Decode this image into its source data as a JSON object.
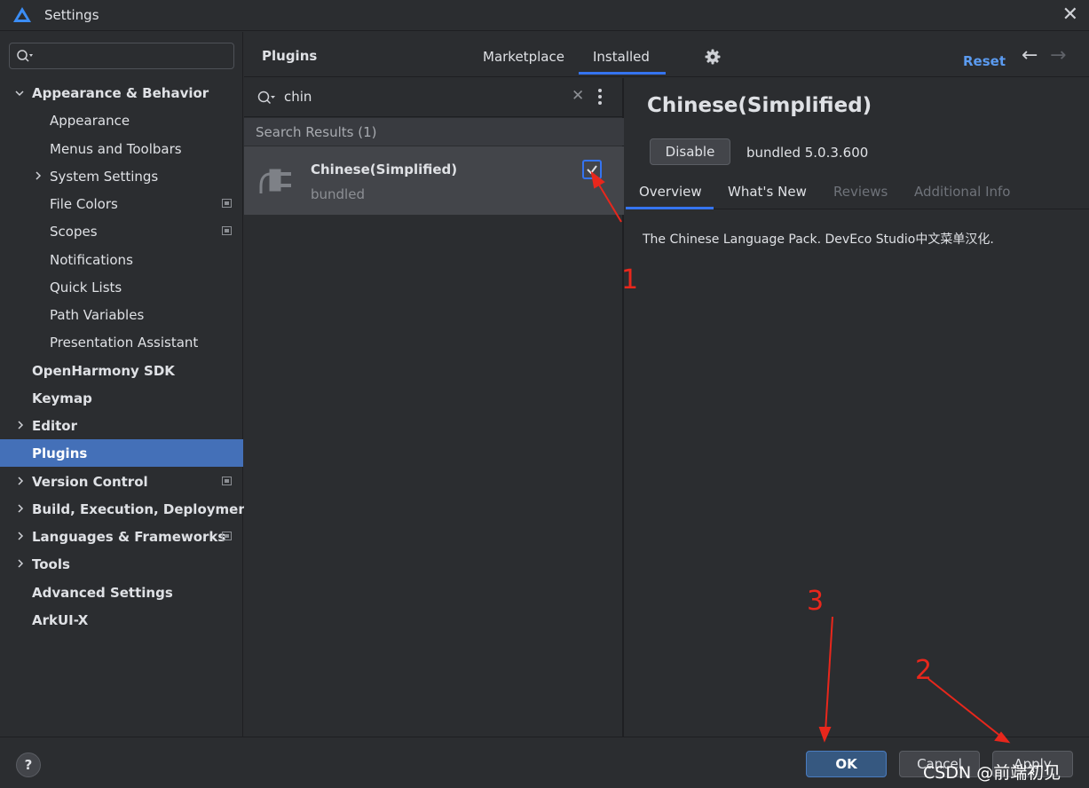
{
  "window": {
    "title": "Settings",
    "close_symbol": "✕"
  },
  "sidebar": {
    "search_placeholder": "",
    "items": [
      {
        "label": "Appearance & Behavior"
      },
      {
        "label": "Appearance"
      },
      {
        "label": "Menus and Toolbars"
      },
      {
        "label": "System Settings"
      },
      {
        "label": "File Colors"
      },
      {
        "label": "Scopes"
      },
      {
        "label": "Notifications"
      },
      {
        "label": "Quick Lists"
      },
      {
        "label": "Path Variables"
      },
      {
        "label": "Presentation Assistant"
      },
      {
        "label": "OpenHarmony SDK"
      },
      {
        "label": "Keymap"
      },
      {
        "label": "Editor"
      },
      {
        "label": "Plugins"
      },
      {
        "label": "Version Control"
      },
      {
        "label": "Build, Execution, Deployment"
      },
      {
        "label": "Languages & Frameworks"
      },
      {
        "label": "Tools"
      },
      {
        "label": "Advanced Settings"
      },
      {
        "label": "ArkUI-X"
      }
    ]
  },
  "header": {
    "title": "Plugins",
    "tabs": [
      {
        "label": "Marketplace"
      },
      {
        "label": "Installed"
      }
    ],
    "active_tab": "Installed",
    "reset_label": "Reset",
    "back_symbol": "←",
    "forward_symbol": "→"
  },
  "plugin_list": {
    "search_value": "chin",
    "clear_symbol": "✕",
    "results_header": "Search Results (1)",
    "items": [
      {
        "name": "Chinese(Simplified)",
        "subtitle": "bundled",
        "enabled": true
      }
    ]
  },
  "detail": {
    "title": "Chinese(Simplified)",
    "disable_label": "Disable",
    "version": "bundled 5.0.3.600",
    "tabs": [
      {
        "label": "Overview"
      },
      {
        "label": "What's New"
      },
      {
        "label": "Reviews"
      },
      {
        "label": "Additional Info"
      }
    ],
    "active_tab": "Overview",
    "description": "The Chinese Language Pack. DevEco Studio中文菜单汉化."
  },
  "footer": {
    "help_label": "?",
    "ok_label": "OK",
    "cancel_label": "Cancel",
    "apply_label": "Apply"
  },
  "annotations": {
    "step1": "1",
    "step2": "2",
    "step3": "3",
    "color": "#e8271c"
  },
  "watermark": "CSDN @前端初见",
  "colors": {
    "accent": "#3574f0",
    "selected": "#4470b8",
    "link": "#5b9bf0",
    "background": "#2b2d30"
  }
}
